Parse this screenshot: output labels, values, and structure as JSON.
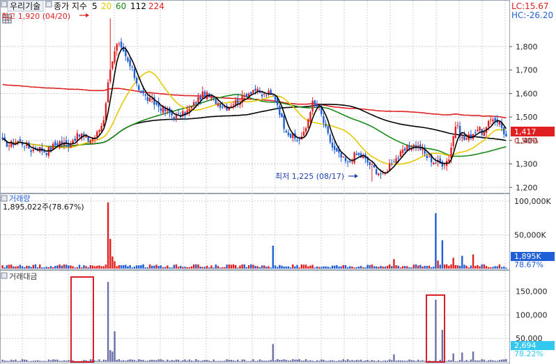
{
  "toolbar": {
    "tabs": [
      {
        "label": "우리기술"
      },
      {
        "label": "종가 지수"
      }
    ],
    "ma": [
      {
        "label": "5",
        "color": "#000000"
      },
      {
        "label": "20",
        "color": "#e8c800"
      },
      {
        "label": "60",
        "color": "#1a8a1a"
      },
      {
        "label": "112",
        "color": "#000000"
      },
      {
        "label": "224",
        "color": "#e02020"
      }
    ],
    "lc": "LC:15.67",
    "hc": "HC:-26.20"
  },
  "colors": {
    "up": "#e02020",
    "down": "#1f5fd6",
    "grid": "#c8cdd6",
    "volume_amount": "#6b6fa8",
    "highlight_box": "#d81f26",
    "price_badge": "#e02020",
    "volume_badge": "#1f5fd6",
    "amount_badge": "#33c8f0"
  },
  "chart_data": [
    {
      "type": "candlestick",
      "title": "우리기술",
      "y_ticks": [
        "1,800",
        "1,700",
        "1,600",
        "1,500",
        "1,400",
        "1,300",
        "1,200"
      ],
      "ylim": [
        1180,
        1945
      ],
      "annotations": {
        "high_label": "최고 1,920 (04/20)",
        "high_value": 1920,
        "low_label": "최저 1,225 (08/17)",
        "low_value": 1225
      },
      "last_price": "1,417",
      "change_pct": "0.50%",
      "ohlc_anchors": [
        1395,
        1380,
        1400,
        1385,
        1360,
        1370,
        1350,
        1375,
        1395,
        1380,
        1410,
        1425,
        1400,
        1420,
        1480,
        1720,
        1810,
        1760,
        1700,
        1620,
        1580,
        1560,
        1540,
        1520,
        1500,
        1510,
        1530,
        1570,
        1600,
        1580,
        1560,
        1540,
        1560,
        1570,
        1600,
        1620,
        1590,
        1600,
        1580,
        1470,
        1420,
        1400,
        1430,
        1560,
        1540,
        1440,
        1360,
        1330,
        1300,
        1340,
        1330,
        1300,
        1270,
        1250,
        1310,
        1330,
        1360,
        1380,
        1370,
        1330,
        1310,
        1300,
        1320,
        1470,
        1400,
        1420,
        1450,
        1430,
        1500,
        1480,
        1417
      ]
    },
    {
      "type": "bar",
      "title": "거래량",
      "value_label": "1,895,022주(78.67%)",
      "y_ticks": [
        "100,000K",
        "50,000K"
      ],
      "ylim": [
        0,
        105000
      ],
      "last_value": "1,895K",
      "last_pct": "78.67%"
    },
    {
      "type": "bar",
      "title": "거래대금",
      "y_ticks": [
        "150,000",
        "100,000",
        "50,000"
      ],
      "ylim": [
        0,
        185000
      ],
      "last_value": "2,694",
      "last_pct": "78.22%"
    }
  ]
}
